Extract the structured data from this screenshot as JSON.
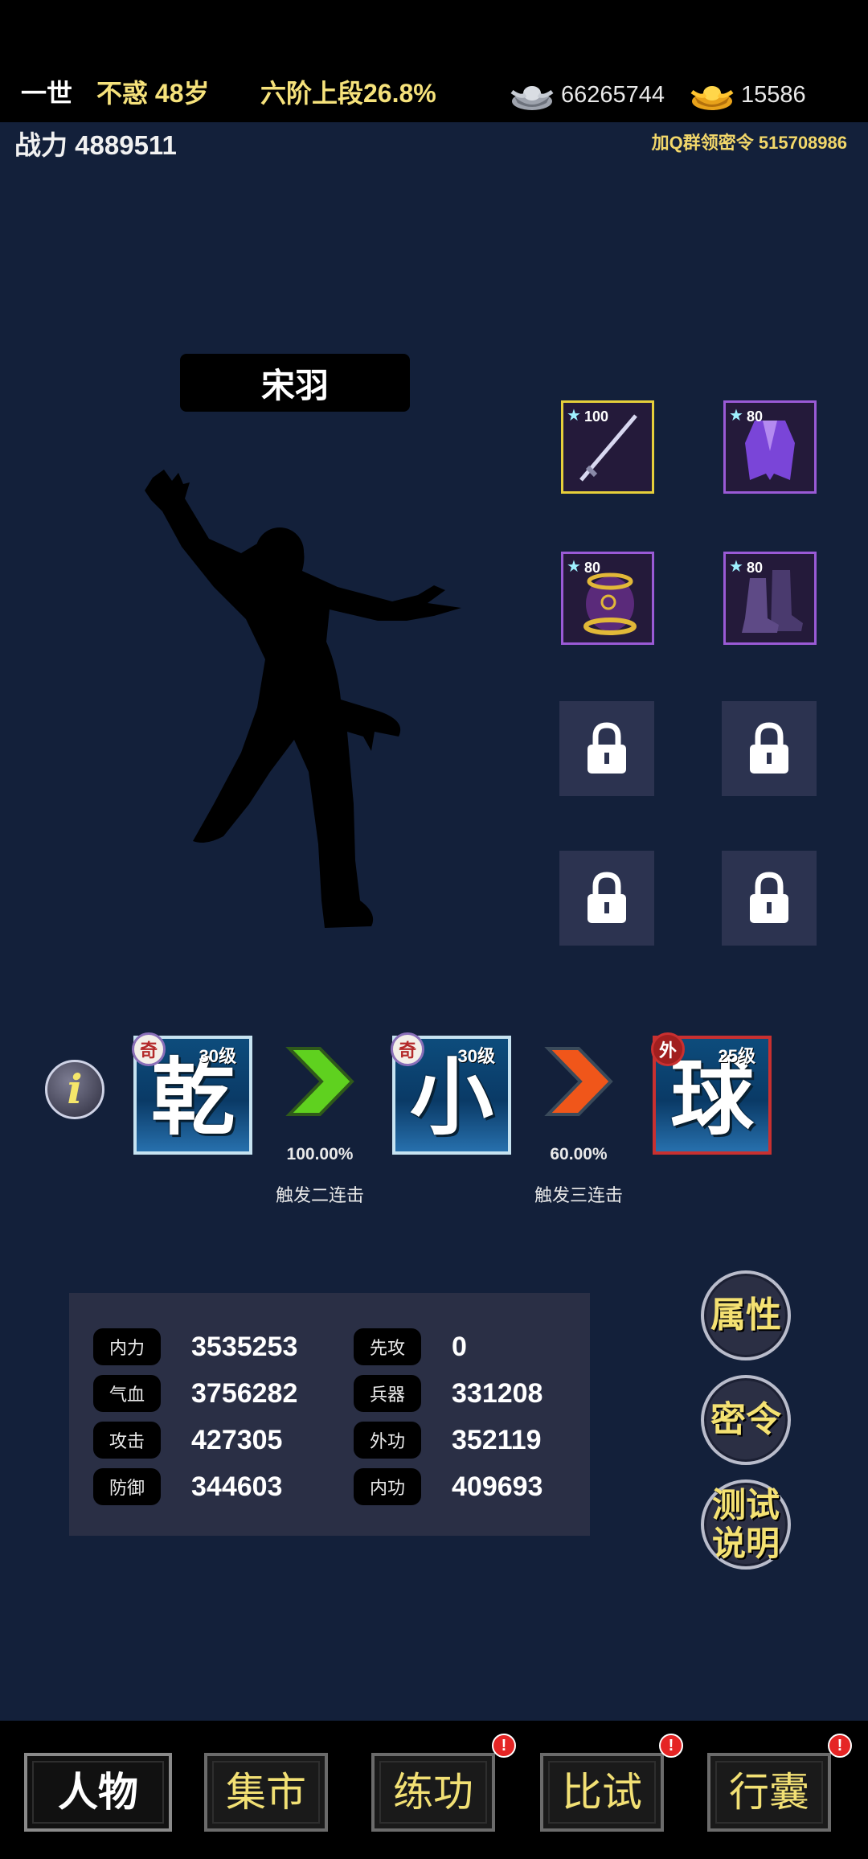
{
  "status": {
    "lifetime": "一世",
    "age": "不惑 48岁",
    "realm": "六阶上段26.8%",
    "silver": "66265744",
    "gold": "15586",
    "silver_icon": "silver-ingot-icon",
    "gold_icon": "gold-ingot-icon"
  },
  "header": {
    "combat_power": "战力 4889511",
    "qq_note": "加Q群领密令 515708986"
  },
  "character": {
    "name": "宋羽"
  },
  "equipment": [
    {
      "slot": "weapon",
      "icon": "sword-icon",
      "level": "100",
      "quality": "gold"
    },
    {
      "slot": "armor",
      "icon": "robe-icon",
      "level": "80",
      "quality": "purple"
    },
    {
      "slot": "bracer",
      "icon": "bracer-icon",
      "level": "80",
      "quality": "purple"
    },
    {
      "slot": "boots",
      "icon": "boots-icon",
      "level": "80",
      "quality": "purple"
    }
  ],
  "skills": [
    {
      "badge": "奇",
      "char": "乾",
      "level": "30级"
    },
    {
      "badge": "奇",
      "char": "小",
      "level": "30级"
    },
    {
      "badge": "外",
      "char": "球",
      "level": "25级"
    }
  ],
  "combos": [
    {
      "chance": "100.00%",
      "label": "触发二连击",
      "color": "#5fd11f"
    },
    {
      "chance": "60.00%",
      "label": "触发三连击",
      "color": "#f0561a"
    }
  ],
  "stats": [
    {
      "label": "内力",
      "value": "3535253"
    },
    {
      "label": "先攻",
      "value": "0"
    },
    {
      "label": "气血",
      "value": "3756282"
    },
    {
      "label": "兵器",
      "value": "331208"
    },
    {
      "label": "攻击",
      "value": "427305"
    },
    {
      "label": "外功",
      "value": "352119"
    },
    {
      "label": "防御",
      "value": "344603"
    },
    {
      "label": "内功",
      "value": "409693"
    }
  ],
  "side_buttons": {
    "attributes": "属性",
    "code": "密令",
    "test_line1": "测试",
    "test_line2": "说明"
  },
  "nav": {
    "items": [
      {
        "label": "人物",
        "active": true,
        "alert": ""
      },
      {
        "label": "集市",
        "active": false,
        "alert": ""
      },
      {
        "label": "练功",
        "active": false,
        "alert": "!"
      },
      {
        "label": "比试",
        "active": false,
        "alert": "!"
      },
      {
        "label": "行囊",
        "active": false,
        "alert": "!"
      }
    ]
  }
}
